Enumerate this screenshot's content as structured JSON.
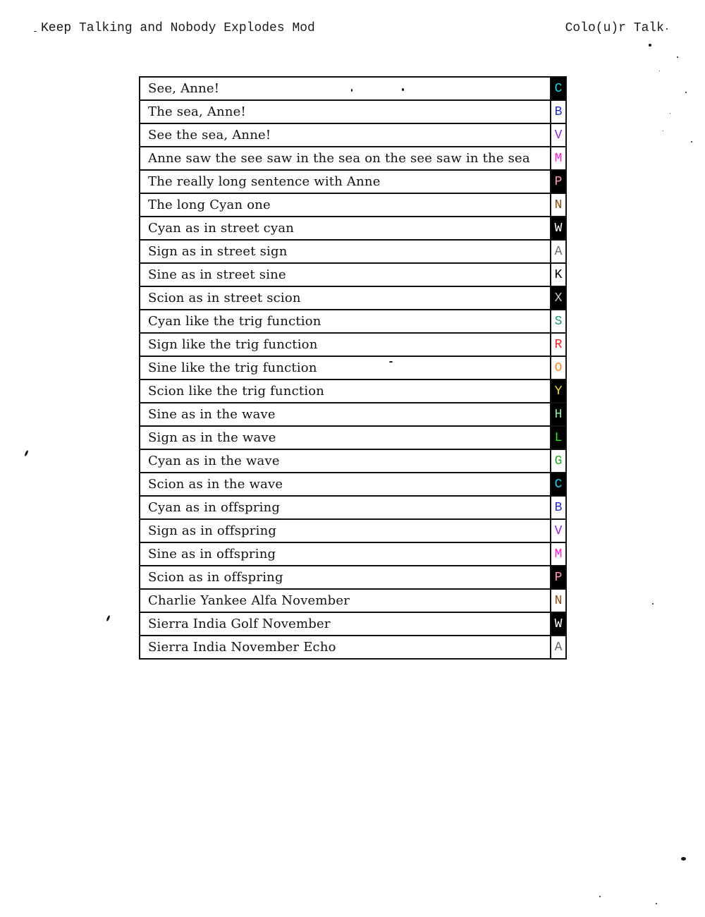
{
  "header": {
    "left": "Keep Talking and Nobody Explodes Mod",
    "right": "Colo(u)r Talk"
  },
  "rows": [
    {
      "phrase": "See, Anne!",
      "letter": "C",
      "color": "#22d3e6",
      "bg": "#000000"
    },
    {
      "phrase": "The sea, Anne!",
      "letter": "B",
      "color": "#1f2fd8",
      "bg": "#ffffff"
    },
    {
      "phrase": "See the sea, Anne!",
      "letter": "V",
      "color": "#9b1fe8",
      "bg": "#ffffff"
    },
    {
      "phrase": "Anne saw the see saw in the sea on the see saw in the sea",
      "letter": "M",
      "color": "#ff1fe0",
      "bg": "#ffffff"
    },
    {
      "phrase": "The really long sentence with Anne",
      "letter": "P",
      "color": "#ff9ab8",
      "bg": "#000000"
    },
    {
      "phrase": "The long Cyan one",
      "letter": "N",
      "color": "#8b4a12",
      "bg": "#ffffff"
    },
    {
      "phrase": "Cyan as in street cyan",
      "letter": "W",
      "color": "#ffffff",
      "bg": "#000000"
    },
    {
      "phrase": "Sign as in street sign",
      "letter": "A",
      "color": "#666666",
      "bg": "#ffffff"
    },
    {
      "phrase": "Sine as in street sine",
      "letter": "K",
      "color": "#000000",
      "bg": "#ffffff"
    },
    {
      "phrase": "Scion as in street scion",
      "letter": "X",
      "color": "#cccccc",
      "bg": "#000000"
    },
    {
      "phrase": "Cyan like the trig function",
      "letter": "S",
      "color": "#1f9a6a",
      "bg": "#ffffff"
    },
    {
      "phrase": "Sign like the trig function",
      "letter": "R",
      "color": "#ff1f1f",
      "bg": "#ffffff"
    },
    {
      "phrase": "Sine like the trig function",
      "letter": "O",
      "color": "#ff8a1f",
      "bg": "#ffffff"
    },
    {
      "phrase": "Scion like the trig function",
      "letter": "Y",
      "color": "#f5e61f",
      "bg": "#000000"
    },
    {
      "phrase": "Sine as in the wave",
      "letter": "H",
      "color": "#8ee8a8",
      "bg": "#000000"
    },
    {
      "phrase": "Sign as in the wave",
      "letter": "L",
      "color": "#2ee81f",
      "bg": "#000000"
    },
    {
      "phrase": "Cyan as in the wave",
      "letter": "G",
      "color": "#1fa81f",
      "bg": "#ffffff"
    },
    {
      "phrase": "Scion as in the wave",
      "letter": "C",
      "color": "#22d3e6",
      "bg": "#000000"
    },
    {
      "phrase": "Cyan as in offspring",
      "letter": "B",
      "color": "#1f2fd8",
      "bg": "#ffffff"
    },
    {
      "phrase": "Sign as in offspring",
      "letter": "V",
      "color": "#9b1fe8",
      "bg": "#ffffff"
    },
    {
      "phrase": "Sine as in offspring",
      "letter": "M",
      "color": "#ff1fe0",
      "bg": "#ffffff"
    },
    {
      "phrase": "Scion as in offspring",
      "letter": "P",
      "color": "#ff9ab8",
      "bg": "#000000"
    },
    {
      "phrase": "Charlie Yankee Alfa November",
      "letter": "N",
      "color": "#8b4a12",
      "bg": "#ffffff"
    },
    {
      "phrase": "Sierra India Golf November",
      "letter": "W",
      "color": "#ffffff",
      "bg": "#000000"
    },
    {
      "phrase": "Sierra India November Echo",
      "letter": "A",
      "color": "#666666",
      "bg": "#ffffff"
    }
  ]
}
